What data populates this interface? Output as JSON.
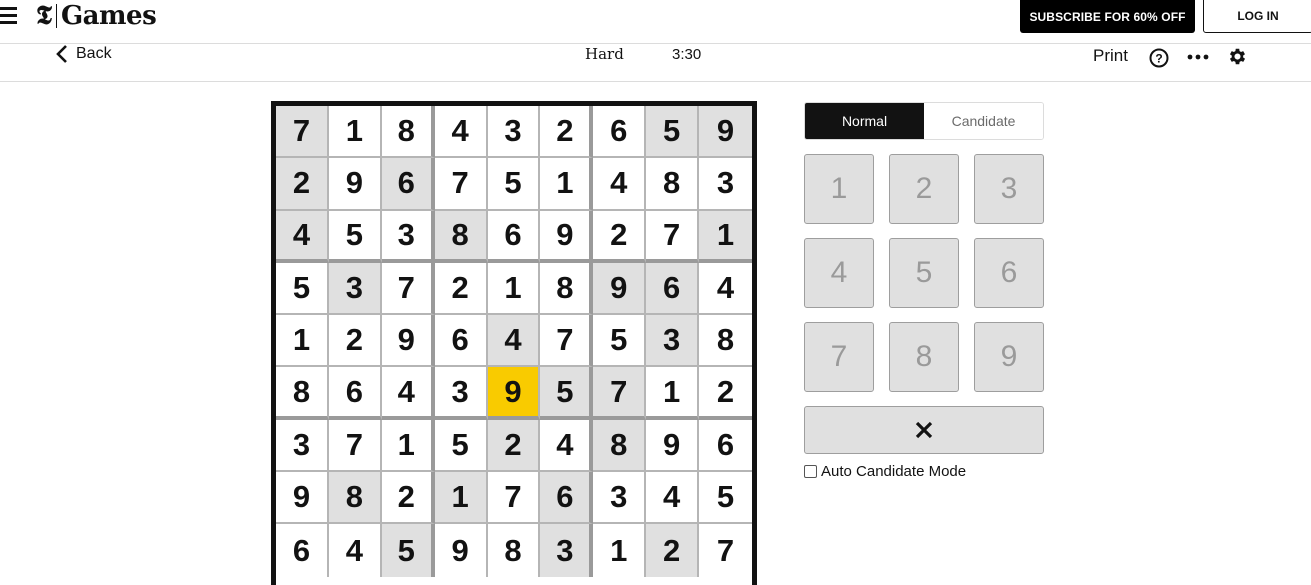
{
  "header": {
    "logo_mark": "𝕿",
    "logo_text": "Games",
    "subscribe_label": "SUBSCRIBE FOR 60% OFF",
    "login_label": "LOG IN"
  },
  "toolbar": {
    "back_label": "Back",
    "difficulty": "Hard",
    "timer": "3:30",
    "print_label": "Print",
    "help_glyph": "?"
  },
  "board": {
    "selected": {
      "row": 5,
      "col": 4
    },
    "rows": [
      [
        "7",
        "1",
        "8",
        "4",
        "3",
        "2",
        "6",
        "5",
        "9"
      ],
      [
        "2",
        "9",
        "6",
        "7",
        "5",
        "1",
        "4",
        "8",
        "3"
      ],
      [
        "4",
        "5",
        "3",
        "8",
        "6",
        "9",
        "2",
        "7",
        "1"
      ],
      [
        "5",
        "3",
        "7",
        "2",
        "1",
        "8",
        "9",
        "6",
        "4"
      ],
      [
        "1",
        "2",
        "9",
        "6",
        "4",
        "7",
        "5",
        "3",
        "8"
      ],
      [
        "8",
        "6",
        "4",
        "3",
        "9",
        "5",
        "7",
        "1",
        "2"
      ],
      [
        "3",
        "7",
        "1",
        "5",
        "2",
        "4",
        "8",
        "9",
        "6"
      ],
      [
        "9",
        "8",
        "2",
        "1",
        "7",
        "6",
        "3",
        "4",
        "5"
      ],
      [
        "6",
        "4",
        "5",
        "9",
        "8",
        "3",
        "1",
        "2",
        "7"
      ]
    ],
    "shaded": [
      [
        1,
        0,
        0,
        0,
        0,
        0,
        0,
        1,
        1
      ],
      [
        1,
        0,
        1,
        0,
        0,
        0,
        0,
        0,
        0
      ],
      [
        1,
        0,
        0,
        1,
        0,
        0,
        0,
        0,
        1
      ],
      [
        0,
        1,
        0,
        0,
        0,
        0,
        1,
        1,
        0
      ],
      [
        0,
        0,
        0,
        0,
        1,
        0,
        0,
        1,
        0
      ],
      [
        0,
        0,
        0,
        0,
        0,
        1,
        1,
        0,
        0
      ],
      [
        0,
        0,
        0,
        0,
        1,
        0,
        1,
        0,
        0
      ],
      [
        0,
        1,
        0,
        1,
        0,
        1,
        0,
        0,
        0
      ],
      [
        0,
        0,
        1,
        0,
        0,
        1,
        0,
        1,
        0
      ]
    ],
    "colors": {
      "selected": "#f9cb00",
      "shaded": "#e0e0e0"
    }
  },
  "controls": {
    "modes": [
      {
        "label": "Normal",
        "active": true
      },
      {
        "label": "Candidate",
        "active": false
      }
    ],
    "keys": [
      "1",
      "2",
      "3",
      "4",
      "5",
      "6",
      "7",
      "8",
      "9"
    ],
    "erase_glyph": "✕",
    "auto_candidate_label": "Auto Candidate Mode",
    "auto_candidate_checked": false
  }
}
